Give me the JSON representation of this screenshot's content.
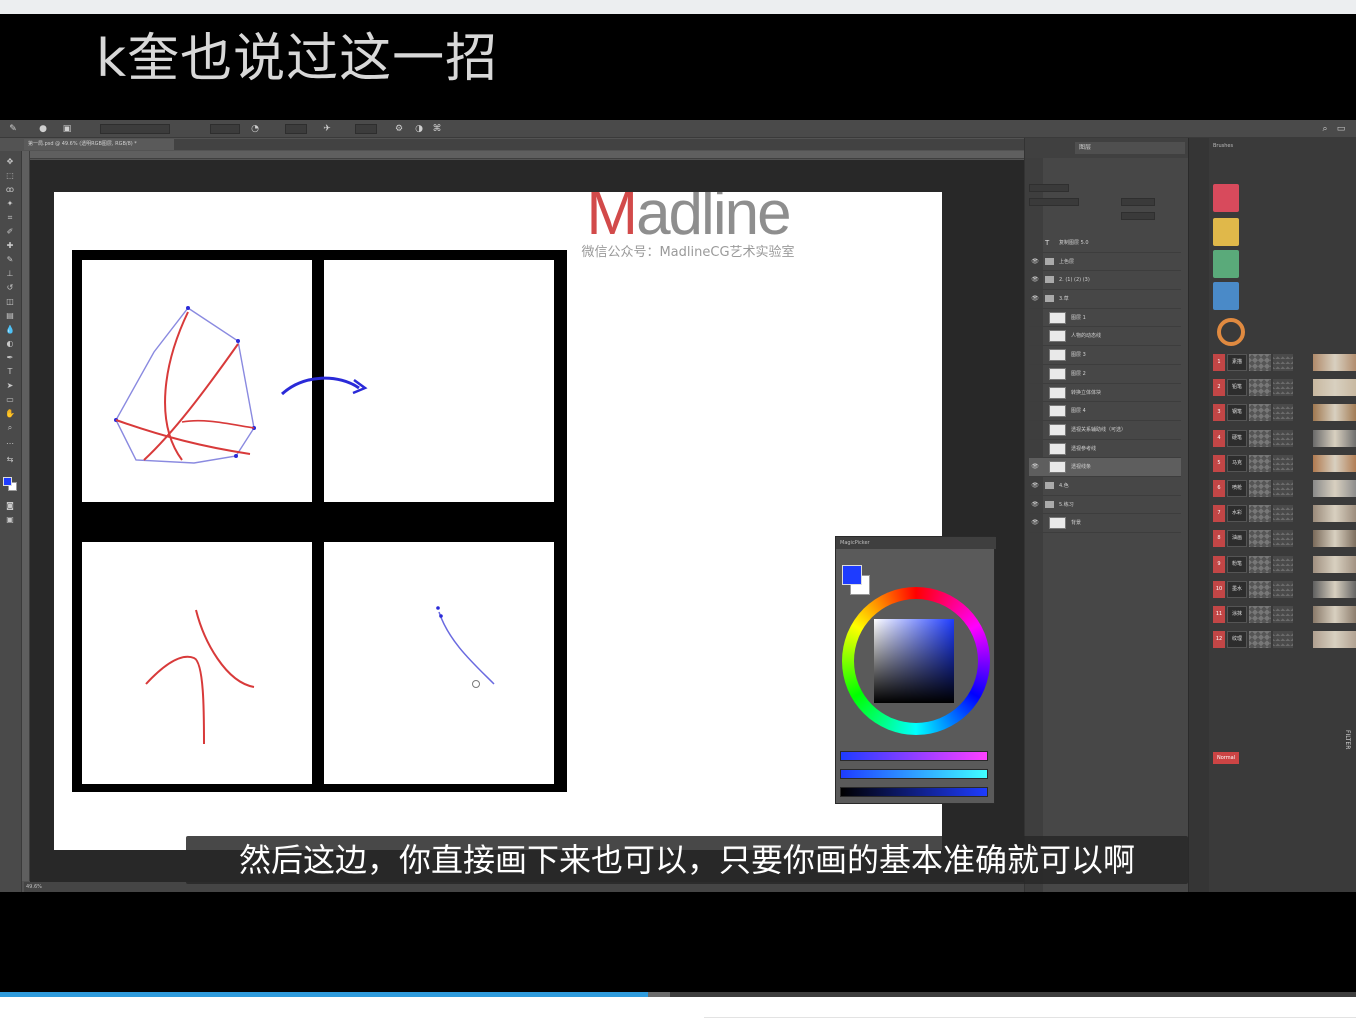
{
  "video_title": "k奎也说过这一招",
  "subtitle": "然后这边，你直接画下来也可以，只要你画的基本准确就可以啊",
  "watermark": {
    "logo_accent": "M",
    "logo_rest": "adline",
    "tagline": "微信公众号：MadlineCG艺术实验室"
  },
  "progress": {
    "played_fraction": 0.478,
    "buffered_fraction": 0.494
  },
  "photoshop": {
    "document_tab": "第一局.psd @ 49.6% (透明RGB图层, RGB/8) *",
    "status_text": "49.6%",
    "layers_tab": "图层",
    "layers": [
      {
        "name": "复制图层 5.0",
        "kind": "text",
        "visible": false
      },
      {
        "name": "上色层",
        "kind": "folder",
        "visible": true
      },
      {
        "name": "2. (1) (2) (3)",
        "kind": "folder",
        "visible": true
      },
      {
        "name": "3.草",
        "kind": "folder",
        "visible": true
      },
      {
        "name": "图层 1",
        "kind": "layer",
        "visible": false
      },
      {
        "name": "人物的动态线",
        "kind": "layer",
        "visible": false
      },
      {
        "name": "图层 3",
        "kind": "layer",
        "visible": false
      },
      {
        "name": "图层 2",
        "kind": "layer",
        "visible": false
      },
      {
        "name": "转换立体体块",
        "kind": "layer",
        "visible": false
      },
      {
        "name": "图层 4",
        "kind": "layer",
        "visible": false
      },
      {
        "name": "透视关系辅助线（可选）",
        "kind": "layer",
        "visible": false
      },
      {
        "name": "透视参考线",
        "kind": "layer",
        "visible": false
      },
      {
        "name": "透视线条",
        "kind": "layer",
        "visible": true,
        "selected": true
      },
      {
        "name": "4.色",
        "kind": "folder",
        "visible": true
      },
      {
        "name": "5.练习",
        "kind": "folder",
        "visible": true
      },
      {
        "name": "背景",
        "kind": "layer",
        "visible": true
      }
    ],
    "brush_panel_title": "Brushes",
    "brush_numbers": [
      "1",
      "2",
      "3",
      "4",
      "5",
      "6",
      "7",
      "8",
      "9",
      "10",
      "11",
      "12"
    ],
    "brush_labels": [
      "素描",
      "铅笔",
      "钢笔",
      "硬笔",
      "马克",
      "喷枪",
      "水彩",
      "油画",
      "粉笔",
      "墨水",
      "涂抹",
      "纹理"
    ],
    "filter_label": "FILTER",
    "normal_label": "Normal",
    "magicpicker_title": "MagicPicker",
    "colors": {
      "foreground": "#1e3cff",
      "background": "#ffffff",
      "stroke_red": "#d83a3a",
      "stroke_blue": "#2a2ad8"
    }
  }
}
